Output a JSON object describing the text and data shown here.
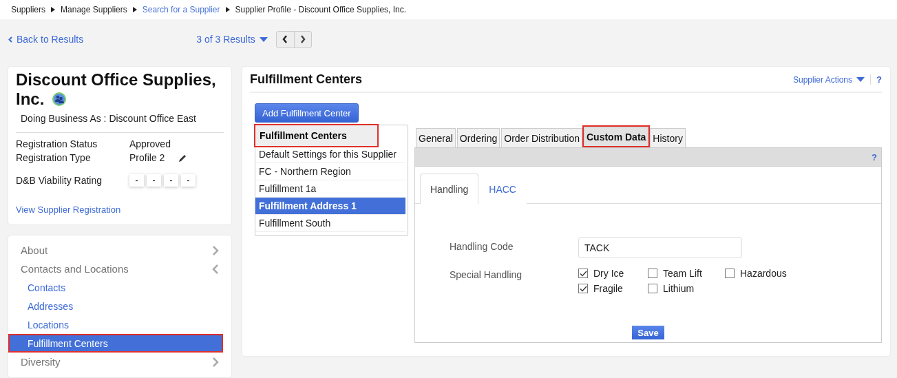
{
  "breadcrumbs": [
    {
      "label": "Suppliers",
      "link": false
    },
    {
      "label": "Manage Suppliers",
      "link": false
    },
    {
      "label": "Search for a Supplier",
      "link": true
    },
    {
      "label": "Supplier Profile - Discount Office Supplies, Inc.",
      "link": false
    }
  ],
  "nav": {
    "back": "Back to Results",
    "results": "3 of 3 Results"
  },
  "supplier": {
    "name": "Discount Office Supplies, Inc.",
    "dba": "Doing Business As : Discount Office East",
    "fields": [
      {
        "label": "Registration Status",
        "value": "Approved",
        "editable": false
      },
      {
        "label": "Registration Type",
        "value": "Profile 2",
        "editable": true
      }
    ],
    "rating": {
      "label": "D&B Viability Rating",
      "cells": [
        "-",
        "-",
        "-",
        "-"
      ]
    },
    "link": "View Supplier Registration"
  },
  "sidebar": {
    "items": [
      {
        "label": "About",
        "expanded": false
      },
      {
        "label": "Contacts and Locations",
        "expanded": true,
        "children": [
          {
            "label": "Contacts",
            "selected": false,
            "highlighted": false
          },
          {
            "label": "Addresses",
            "selected": false,
            "highlighted": false
          },
          {
            "label": "Locations",
            "selected": false,
            "highlighted": false
          },
          {
            "label": "Fulfillment Centers",
            "selected": true,
            "highlighted": true
          }
        ]
      },
      {
        "label": "Diversity",
        "expanded": false
      }
    ]
  },
  "panel": {
    "title": "Fulfillment Centers",
    "actions": "Supplier Actions",
    "help": "?",
    "add_button": "Add Fulfillment Center",
    "list": {
      "header": "Fulfillment Centers",
      "highlighted": true,
      "items": [
        {
          "label": "Default Settings for this Supplier",
          "selected": false
        },
        {
          "label": "FC - Northern Region",
          "selected": false
        },
        {
          "label": "Fulfillment 1a",
          "selected": false
        },
        {
          "label": "Fulfillment Address 1",
          "selected": true
        },
        {
          "label": "Fulfillment South",
          "selected": false
        }
      ]
    },
    "tabs": [
      {
        "label": "General",
        "selected": false,
        "highlighted": false
      },
      {
        "label": "Ordering",
        "selected": false,
        "highlighted": false
      },
      {
        "label": "Order Distribution",
        "selected": false,
        "highlighted": false
      },
      {
        "label": "Custom Data",
        "selected": true,
        "highlighted": true
      },
      {
        "label": "History",
        "selected": false,
        "highlighted": false
      }
    ],
    "tab_help": "?",
    "subtabs": [
      {
        "label": "Handling",
        "selected": true
      },
      {
        "label": "HACC",
        "selected": false
      }
    ],
    "form": {
      "code_label": "Handling Code",
      "code_value": "TACK",
      "special_label": "Special Handling",
      "options": [
        {
          "label": "Dry Ice",
          "checked": true
        },
        {
          "label": "Team Lift",
          "checked": false
        },
        {
          "label": "Hazardous",
          "checked": false
        },
        {
          "label": "Fragile",
          "checked": true
        },
        {
          "label": "Lithium",
          "checked": false
        }
      ],
      "save": "Save"
    }
  }
}
